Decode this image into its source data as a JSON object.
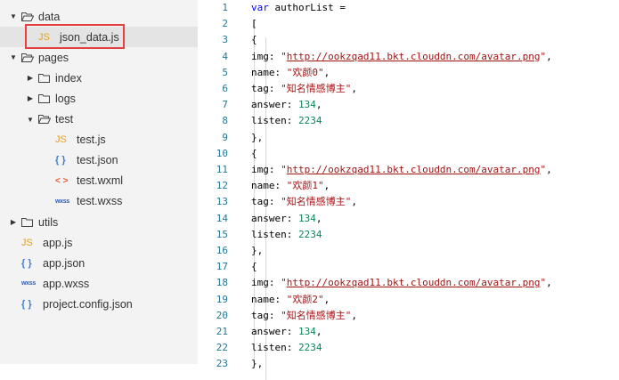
{
  "tree": [
    {
      "label": "data",
      "kind": "folder",
      "open": true,
      "depth": 0,
      "icon": "folder-open-icon"
    },
    {
      "label": "json_data.js",
      "kind": "js",
      "depth": 1,
      "selected": true,
      "icon": "js-file-icon",
      "badge": "JS"
    },
    {
      "label": "pages",
      "kind": "folder",
      "open": true,
      "depth": 0,
      "icon": "folder-open-icon"
    },
    {
      "label": "index",
      "kind": "folder",
      "open": false,
      "depth": 1,
      "icon": "folder-icon"
    },
    {
      "label": "logs",
      "kind": "folder",
      "open": false,
      "depth": 1,
      "icon": "folder-icon"
    },
    {
      "label": "test",
      "kind": "folder",
      "open": true,
      "depth": 1,
      "icon": "folder-open-icon"
    },
    {
      "label": "test.js",
      "kind": "js",
      "depth": 2,
      "icon": "js-file-icon",
      "badge": "JS"
    },
    {
      "label": "test.json",
      "kind": "json",
      "depth": 2,
      "icon": "json-file-icon",
      "badge": "{ }"
    },
    {
      "label": "test.wxml",
      "kind": "wxml",
      "depth": 2,
      "icon": "wxml-file-icon",
      "badge": "< >"
    },
    {
      "label": "test.wxss",
      "kind": "wxss",
      "depth": 2,
      "icon": "wxss-file-icon",
      "badge": "wxss"
    },
    {
      "label": "utils",
      "kind": "folder",
      "open": false,
      "depth": 0,
      "icon": "folder-icon"
    },
    {
      "label": "app.js",
      "kind": "js",
      "depth": 0,
      "icon": "js-file-icon",
      "badge": "JS"
    },
    {
      "label": "app.json",
      "kind": "json",
      "depth": 0,
      "icon": "json-file-icon",
      "badge": "{ }"
    },
    {
      "label": "app.wxss",
      "kind": "wxss",
      "depth": 0,
      "icon": "wxss-file-icon",
      "badge": "wxss"
    },
    {
      "label": "project.config.json",
      "kind": "json",
      "depth": 0,
      "icon": "json-file-icon",
      "badge": "{ }"
    }
  ],
  "editor": {
    "colors": {
      "keyword": "#0000ff",
      "string": "#a31515",
      "number": "#098658",
      "line_number": "#237893"
    },
    "lines": [
      {
        "n": "1",
        "tokens": [
          [
            "kw",
            "var"
          ],
          [
            "plain",
            " authorList ="
          ]
        ]
      },
      {
        "n": "2",
        "tokens": [
          [
            "plain",
            "  ["
          ]
        ]
      },
      {
        "n": "3",
        "tokens": [
          [
            "plain",
            "    {"
          ]
        ]
      },
      {
        "n": "4",
        "tokens": [
          [
            "plain",
            "      img: "
          ],
          [
            "str",
            "\""
          ],
          [
            "url",
            "http://ookzqad11.bkt.clouddn.com/avatar.png"
          ],
          [
            "str",
            "\""
          ],
          [
            "plain",
            ","
          ]
        ]
      },
      {
        "n": "5",
        "tokens": [
          [
            "plain",
            "      name: "
          ],
          [
            "str",
            "\"欢颜0\""
          ],
          [
            "plain",
            ","
          ]
        ]
      },
      {
        "n": "6",
        "tokens": [
          [
            "plain",
            "      tag: "
          ],
          [
            "str",
            "\"知名情感博主\""
          ],
          [
            "plain",
            ","
          ]
        ]
      },
      {
        "n": "7",
        "tokens": [
          [
            "plain",
            "      answer: "
          ],
          [
            "num",
            "134"
          ],
          [
            "plain",
            ","
          ]
        ]
      },
      {
        "n": "8",
        "tokens": [
          [
            "plain",
            "      listen: "
          ],
          [
            "num",
            "2234"
          ]
        ]
      },
      {
        "n": "9",
        "tokens": [
          [
            "plain",
            "    },"
          ]
        ]
      },
      {
        "n": "10",
        "tokens": [
          [
            "plain",
            "    {"
          ]
        ]
      },
      {
        "n": "11",
        "tokens": [
          [
            "plain",
            "      img: "
          ],
          [
            "str",
            "\""
          ],
          [
            "url",
            "http://ookzqad11.bkt.clouddn.com/avatar.png"
          ],
          [
            "str",
            "\""
          ],
          [
            "plain",
            ","
          ]
        ]
      },
      {
        "n": "12",
        "tokens": [
          [
            "plain",
            "      name: "
          ],
          [
            "str",
            "\"欢颜1\""
          ],
          [
            "plain",
            ","
          ]
        ]
      },
      {
        "n": "13",
        "tokens": [
          [
            "plain",
            "      tag: "
          ],
          [
            "str",
            "\"知名情感博主\""
          ],
          [
            "plain",
            ","
          ]
        ]
      },
      {
        "n": "14",
        "tokens": [
          [
            "plain",
            "      answer: "
          ],
          [
            "num",
            "134"
          ],
          [
            "plain",
            ","
          ]
        ]
      },
      {
        "n": "15",
        "tokens": [
          [
            "plain",
            "      listen: "
          ],
          [
            "num",
            "2234"
          ]
        ]
      },
      {
        "n": "16",
        "tokens": [
          [
            "plain",
            "    },"
          ]
        ]
      },
      {
        "n": "17",
        "tokens": [
          [
            "plain",
            "    {"
          ]
        ]
      },
      {
        "n": "18",
        "tokens": [
          [
            "plain",
            "      img: "
          ],
          [
            "str",
            "\""
          ],
          [
            "url",
            "http://ookzqad11.bkt.clouddn.com/avatar.png"
          ],
          [
            "str",
            "\""
          ],
          [
            "plain",
            ","
          ]
        ]
      },
      {
        "n": "19",
        "tokens": [
          [
            "plain",
            "      name: "
          ],
          [
            "str",
            "\"欢颜2\""
          ],
          [
            "plain",
            ","
          ]
        ]
      },
      {
        "n": "20",
        "tokens": [
          [
            "plain",
            "      tag: "
          ],
          [
            "str",
            "\"知名情感博主\""
          ],
          [
            "plain",
            ","
          ]
        ]
      },
      {
        "n": "21",
        "tokens": [
          [
            "plain",
            "      answer: "
          ],
          [
            "num",
            "134"
          ],
          [
            "plain",
            ","
          ]
        ]
      },
      {
        "n": "22",
        "tokens": [
          [
            "plain",
            "      listen: "
          ],
          [
            "num",
            "2234"
          ]
        ]
      },
      {
        "n": "23",
        "tokens": [
          [
            "plain",
            "    },"
          ]
        ]
      }
    ]
  }
}
